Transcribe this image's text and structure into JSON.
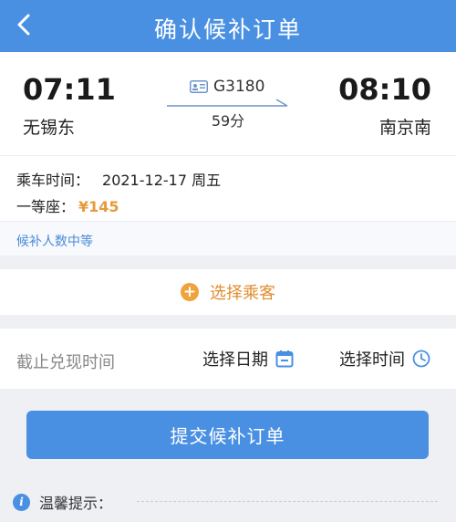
{
  "header": {
    "title": "确认候补订单"
  },
  "train": {
    "departure_time": "07:11",
    "departure_station": "无锡东",
    "arrival_time": "08:10",
    "arrival_station": "南京南",
    "train_number": "G3180",
    "duration": "59分"
  },
  "details": {
    "ride_time_label": "乘车时间：",
    "ride_time_value": "2021-12-17 周五",
    "seat_label": "一等座：",
    "seat_price": "¥145"
  },
  "waitlist": {
    "status_text": "候补人数中等"
  },
  "passenger": {
    "select_label": "选择乘客"
  },
  "deadline": {
    "label": "截止兑现时间",
    "date_label": "选择日期",
    "time_label": "选择时间"
  },
  "submit": {
    "label": "提交候补订单"
  },
  "tips": {
    "label": "温馨提示："
  },
  "colors": {
    "primary": "#4a90e2",
    "accent": "#e69a3c"
  }
}
